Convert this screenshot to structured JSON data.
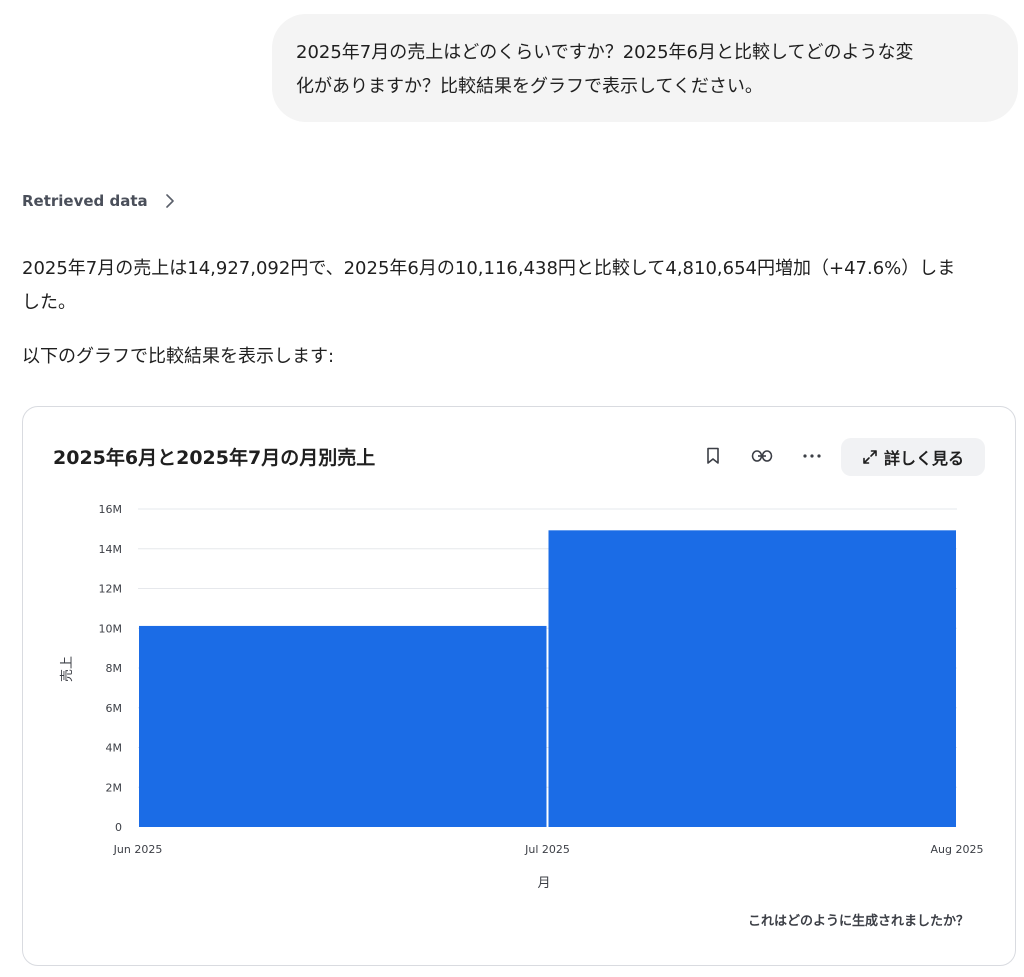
{
  "user_message": {
    "line1": "2025年7月の売上はどのくらいですか？2025年6月と比較してどのような変",
    "line2": "化がありますか？比較結果をグラフで表示してください。"
  },
  "retrieved": {
    "label": "Retrieved data"
  },
  "answer": {
    "line1": "2025年7月の売上は14,927,092円で、2025年6月の10,116,438円と比較して4,810,654円増加（+47.6%）しま",
    "line2": "した。",
    "lead": "以下のグラフで比較結果を表示します:"
  },
  "card": {
    "title": "2025年6月と2025年7月の月別売上",
    "detail_label": "詳しく見る",
    "footer": "これはどのように生成されましたか？",
    "icons": [
      "bookmark-icon",
      "link-icon",
      "more-icon",
      "expand-icon"
    ]
  },
  "colors": {
    "bar": "#1b6ce6",
    "grid": "#e6e8ec"
  },
  "chart_data": {
    "type": "bar",
    "categories": [
      "Jun 2025",
      "Jul 2025"
    ],
    "x_ticks": [
      "Jun 2025",
      "Jul 2025",
      "Aug 2025"
    ],
    "values": [
      10116438,
      14927092
    ],
    "y_ticks": [
      0,
      2000000,
      4000000,
      6000000,
      8000000,
      10000000,
      12000000,
      14000000,
      16000000
    ],
    "y_tick_labels": [
      "0",
      "2M",
      "4M",
      "6M",
      "8M",
      "10M",
      "12M",
      "14M",
      "16M"
    ],
    "ylim": [
      0,
      16000000
    ],
    "xlabel": "月",
    "ylabel": "売上",
    "grid": true
  }
}
